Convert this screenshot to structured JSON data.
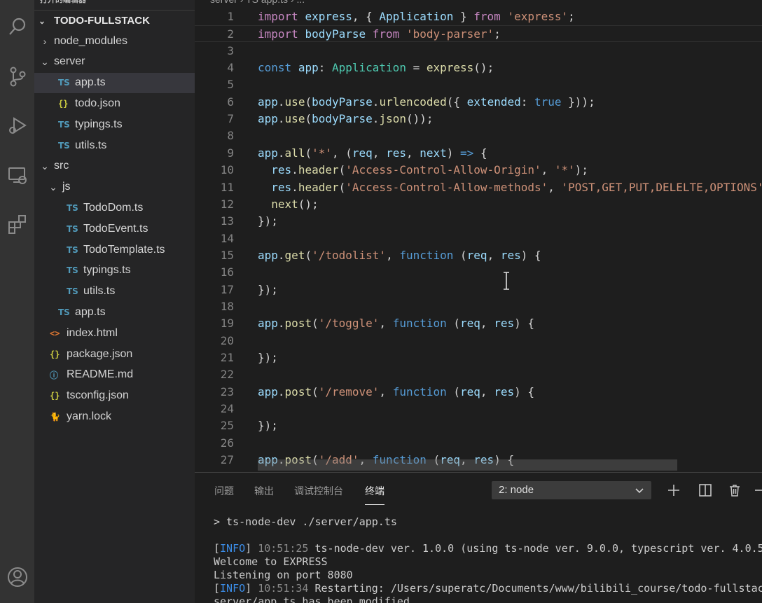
{
  "sidebar": {
    "open_editors_label": "打开的编辑器",
    "root_label": "TODO-FULLSTACK",
    "items": [
      {
        "label": "node_modules",
        "twisty": "›",
        "icon": "",
        "icon_name": "chevron-right-icon"
      },
      {
        "label": "server",
        "twisty": "⌄",
        "icon": "",
        "icon_name": "chevron-down-icon"
      },
      {
        "label": "app.ts",
        "twisty": "",
        "icon": "TS",
        "icon_name": "typescript-file-icon"
      },
      {
        "label": "todo.json",
        "twisty": "",
        "icon": "{}",
        "icon_name": "json-file-icon"
      },
      {
        "label": "typings.ts",
        "twisty": "",
        "icon": "TS",
        "icon_name": "typescript-file-icon"
      },
      {
        "label": "utils.ts",
        "twisty": "",
        "icon": "TS",
        "icon_name": "typescript-file-icon"
      },
      {
        "label": "src",
        "twisty": "⌄",
        "icon": "",
        "icon_name": "chevron-down-icon"
      },
      {
        "label": "js",
        "twisty": "⌄",
        "icon": "",
        "icon_name": "chevron-down-icon"
      },
      {
        "label": "TodoDom.ts",
        "twisty": "",
        "icon": "TS",
        "icon_name": "typescript-file-icon"
      },
      {
        "label": "TodoEvent.ts",
        "twisty": "",
        "icon": "TS",
        "icon_name": "typescript-file-icon"
      },
      {
        "label": "TodoTemplate.ts",
        "twisty": "",
        "icon": "TS",
        "icon_name": "typescript-file-icon"
      },
      {
        "label": "typings.ts",
        "twisty": "",
        "icon": "TS",
        "icon_name": "typescript-file-icon"
      },
      {
        "label": "utils.ts",
        "twisty": "",
        "icon": "TS",
        "icon_name": "typescript-file-icon"
      },
      {
        "label": "app.ts",
        "twisty": "",
        "icon": "TS",
        "icon_name": "typescript-file-icon"
      },
      {
        "label": "index.html",
        "twisty": "",
        "icon": "<>",
        "icon_name": "html-file-icon"
      },
      {
        "label": "package.json",
        "twisty": "",
        "icon": "{}",
        "icon_name": "json-file-icon"
      },
      {
        "label": "README.md",
        "twisty": "",
        "icon": "ⓘ",
        "icon_name": "info-file-icon"
      },
      {
        "label": "tsconfig.json",
        "twisty": "",
        "icon": "{}",
        "icon_name": "json-file-icon"
      },
      {
        "label": "yarn.lock",
        "twisty": "",
        "icon": "🐈",
        "icon_name": "yarn-file-icon"
      }
    ]
  },
  "editor": {
    "breadcrumb": "server  ›  TS app.ts  ›  ...",
    "lines": [
      {
        "n": "1",
        "tokens": [
          [
            "k-kw",
            "import"
          ],
          [
            "k-punc",
            " "
          ],
          [
            "k-var",
            "express"
          ],
          [
            "k-punc",
            ", { "
          ],
          [
            "k-var",
            "Application"
          ],
          [
            "k-punc",
            " } "
          ],
          [
            "k-kw",
            "from"
          ],
          [
            "k-punc",
            " "
          ],
          [
            "k-str",
            "'express'"
          ],
          [
            "k-punc",
            ";"
          ]
        ]
      },
      {
        "n": "2",
        "tokens": [
          [
            "k-kw",
            "import"
          ],
          [
            "k-punc",
            " "
          ],
          [
            "k-var",
            "bodyParse"
          ],
          [
            "k-punc",
            " "
          ],
          [
            "k-kw",
            "from"
          ],
          [
            "k-punc",
            " "
          ],
          [
            "k-str",
            "'body-parser'"
          ],
          [
            "k-punc",
            ";"
          ]
        ]
      },
      {
        "n": "3",
        "tokens": []
      },
      {
        "n": "4",
        "tokens": [
          [
            "k-blue",
            "const"
          ],
          [
            "k-punc",
            " "
          ],
          [
            "k-var",
            "app"
          ],
          [
            "k-punc",
            ": "
          ],
          [
            "k-type",
            "Application"
          ],
          [
            "k-punc",
            " = "
          ],
          [
            "k-fn",
            "express"
          ],
          [
            "k-punc",
            "();"
          ]
        ]
      },
      {
        "n": "5",
        "tokens": []
      },
      {
        "n": "6",
        "tokens": [
          [
            "k-var",
            "app"
          ],
          [
            "k-punc",
            "."
          ],
          [
            "k-fn",
            "use"
          ],
          [
            "k-punc",
            "("
          ],
          [
            "k-var",
            "bodyParse"
          ],
          [
            "k-punc",
            "."
          ],
          [
            "k-fn",
            "urlencoded"
          ],
          [
            "k-punc",
            "({ "
          ],
          [
            "k-var",
            "extended"
          ],
          [
            "k-punc",
            ": "
          ],
          [
            "k-blue",
            "true"
          ],
          [
            "k-punc",
            " }));"
          ]
        ]
      },
      {
        "n": "7",
        "tokens": [
          [
            "k-var",
            "app"
          ],
          [
            "k-punc",
            "."
          ],
          [
            "k-fn",
            "use"
          ],
          [
            "k-punc",
            "("
          ],
          [
            "k-var",
            "bodyParse"
          ],
          [
            "k-punc",
            "."
          ],
          [
            "k-fn",
            "json"
          ],
          [
            "k-punc",
            "());"
          ]
        ]
      },
      {
        "n": "8",
        "tokens": []
      },
      {
        "n": "9",
        "tokens": [
          [
            "k-var",
            "app"
          ],
          [
            "k-punc",
            "."
          ],
          [
            "k-fn",
            "all"
          ],
          [
            "k-punc",
            "("
          ],
          [
            "k-str",
            "'*'"
          ],
          [
            "k-punc",
            ", ("
          ],
          [
            "k-var",
            "req"
          ],
          [
            "k-punc",
            ", "
          ],
          [
            "k-var",
            "res"
          ],
          [
            "k-punc",
            ", "
          ],
          [
            "k-var",
            "next"
          ],
          [
            "k-punc",
            ") "
          ],
          [
            "k-blue",
            "=>"
          ],
          [
            "k-punc",
            " {"
          ]
        ]
      },
      {
        "n": "10",
        "tokens": [
          [
            "k-punc",
            "  "
          ],
          [
            "k-var",
            "res"
          ],
          [
            "k-punc",
            "."
          ],
          [
            "k-fn",
            "header"
          ],
          [
            "k-punc",
            "("
          ],
          [
            "k-str",
            "'Access-Control-Allow-Origin'"
          ],
          [
            "k-punc",
            ", "
          ],
          [
            "k-str",
            "'*'"
          ],
          [
            "k-punc",
            ");"
          ]
        ]
      },
      {
        "n": "11",
        "tokens": [
          [
            "k-punc",
            "  "
          ],
          [
            "k-var",
            "res"
          ],
          [
            "k-punc",
            "."
          ],
          [
            "k-fn",
            "header"
          ],
          [
            "k-punc",
            "("
          ],
          [
            "k-str",
            "'Access-Control-Allow-methods'"
          ],
          [
            "k-punc",
            ", "
          ],
          [
            "k-str",
            "'POST,GET,PUT,DELELTE,OPTIONS'"
          ],
          [
            "k-punc",
            ");"
          ]
        ]
      },
      {
        "n": "12",
        "tokens": [
          [
            "k-punc",
            "  "
          ],
          [
            "k-fn",
            "next"
          ],
          [
            "k-punc",
            "();"
          ]
        ]
      },
      {
        "n": "13",
        "tokens": [
          [
            "k-punc",
            "});"
          ]
        ]
      },
      {
        "n": "14",
        "tokens": []
      },
      {
        "n": "15",
        "tokens": [
          [
            "k-var",
            "app"
          ],
          [
            "k-punc",
            "."
          ],
          [
            "k-fn",
            "get"
          ],
          [
            "k-punc",
            "("
          ],
          [
            "k-str",
            "'/todolist'"
          ],
          [
            "k-punc",
            ", "
          ],
          [
            "k-blue",
            "function"
          ],
          [
            "k-punc",
            " ("
          ],
          [
            "k-var",
            "req"
          ],
          [
            "k-punc",
            ", "
          ],
          [
            "k-var",
            "res"
          ],
          [
            "k-punc",
            ") {"
          ]
        ]
      },
      {
        "n": "16",
        "tokens": []
      },
      {
        "n": "17",
        "tokens": [
          [
            "k-punc",
            "});"
          ]
        ]
      },
      {
        "n": "18",
        "tokens": []
      },
      {
        "n": "19",
        "tokens": [
          [
            "k-var",
            "app"
          ],
          [
            "k-punc",
            "."
          ],
          [
            "k-fn",
            "post"
          ],
          [
            "k-punc",
            "("
          ],
          [
            "k-str",
            "'/toggle'"
          ],
          [
            "k-punc",
            ", "
          ],
          [
            "k-blue",
            "function"
          ],
          [
            "k-punc",
            " ("
          ],
          [
            "k-var",
            "req"
          ],
          [
            "k-punc",
            ", "
          ],
          [
            "k-var",
            "res"
          ],
          [
            "k-punc",
            ") {"
          ]
        ]
      },
      {
        "n": "20",
        "tokens": []
      },
      {
        "n": "21",
        "tokens": [
          [
            "k-punc",
            "});"
          ]
        ]
      },
      {
        "n": "22",
        "tokens": []
      },
      {
        "n": "23",
        "tokens": [
          [
            "k-var",
            "app"
          ],
          [
            "k-punc",
            "."
          ],
          [
            "k-fn",
            "post"
          ],
          [
            "k-punc",
            "("
          ],
          [
            "k-str",
            "'/remove'"
          ],
          [
            "k-punc",
            ", "
          ],
          [
            "k-blue",
            "function"
          ],
          [
            "k-punc",
            " ("
          ],
          [
            "k-var",
            "req"
          ],
          [
            "k-punc",
            ", "
          ],
          [
            "k-var",
            "res"
          ],
          [
            "k-punc",
            ") {"
          ]
        ]
      },
      {
        "n": "24",
        "tokens": []
      },
      {
        "n": "25",
        "tokens": [
          [
            "k-punc",
            "});"
          ]
        ]
      },
      {
        "n": "26",
        "tokens": []
      },
      {
        "n": "27",
        "tokens": [
          [
            "k-var",
            "app"
          ],
          [
            "k-punc",
            "."
          ],
          [
            "k-fn",
            "post"
          ],
          [
            "k-punc",
            "("
          ],
          [
            "k-str",
            "'/add'"
          ],
          [
            "k-punc",
            ", "
          ],
          [
            "k-blue",
            "function"
          ],
          [
            "k-punc",
            " ("
          ],
          [
            "k-var",
            "req"
          ],
          [
            "k-punc",
            ", "
          ],
          [
            "k-var",
            "res"
          ],
          [
            "k-punc",
            ") {"
          ]
        ]
      }
    ]
  },
  "panel": {
    "tabs": [
      "问题",
      "输出",
      "调试控制台",
      "终端"
    ],
    "active_tab": "终端",
    "terminal_select": "2: node",
    "terminal_lines": [
      {
        "parts": [
          [
            "",
            "> ts-node-dev ./server/app.ts"
          ]
        ]
      },
      {
        "parts": [
          [
            "",
            ""
          ]
        ]
      },
      {
        "parts": [
          [
            "",
            "["
          ],
          [
            "t-info",
            "INFO"
          ],
          [
            "",
            "] "
          ],
          [
            "t-time",
            "10:51:25"
          ],
          [
            "",
            " ts-node-dev ver. 1.0.0 (using ts-node ver. 9.0.0, typescript ver. 4.0.5)"
          ]
        ]
      },
      {
        "parts": [
          [
            "",
            "Welcome to EXPRESS"
          ]
        ]
      },
      {
        "parts": [
          [
            "",
            "Listening on port 8080"
          ]
        ]
      },
      {
        "parts": [
          [
            "",
            "["
          ],
          [
            "t-info",
            "INFO"
          ],
          [
            "",
            "] "
          ],
          [
            "t-time",
            "10:51:34"
          ],
          [
            "",
            " Restarting: /Users/superatc/Documents/www/bilibili_course/todo-fullstack/"
          ]
        ]
      },
      {
        "parts": [
          [
            "",
            "server/app.ts has been modified"
          ]
        ]
      }
    ]
  },
  "colors": {
    "activity_bar": "#333333",
    "sidebar": "#252526",
    "editor_bg": "#1e1e1e",
    "selected_row": "#37373d"
  }
}
